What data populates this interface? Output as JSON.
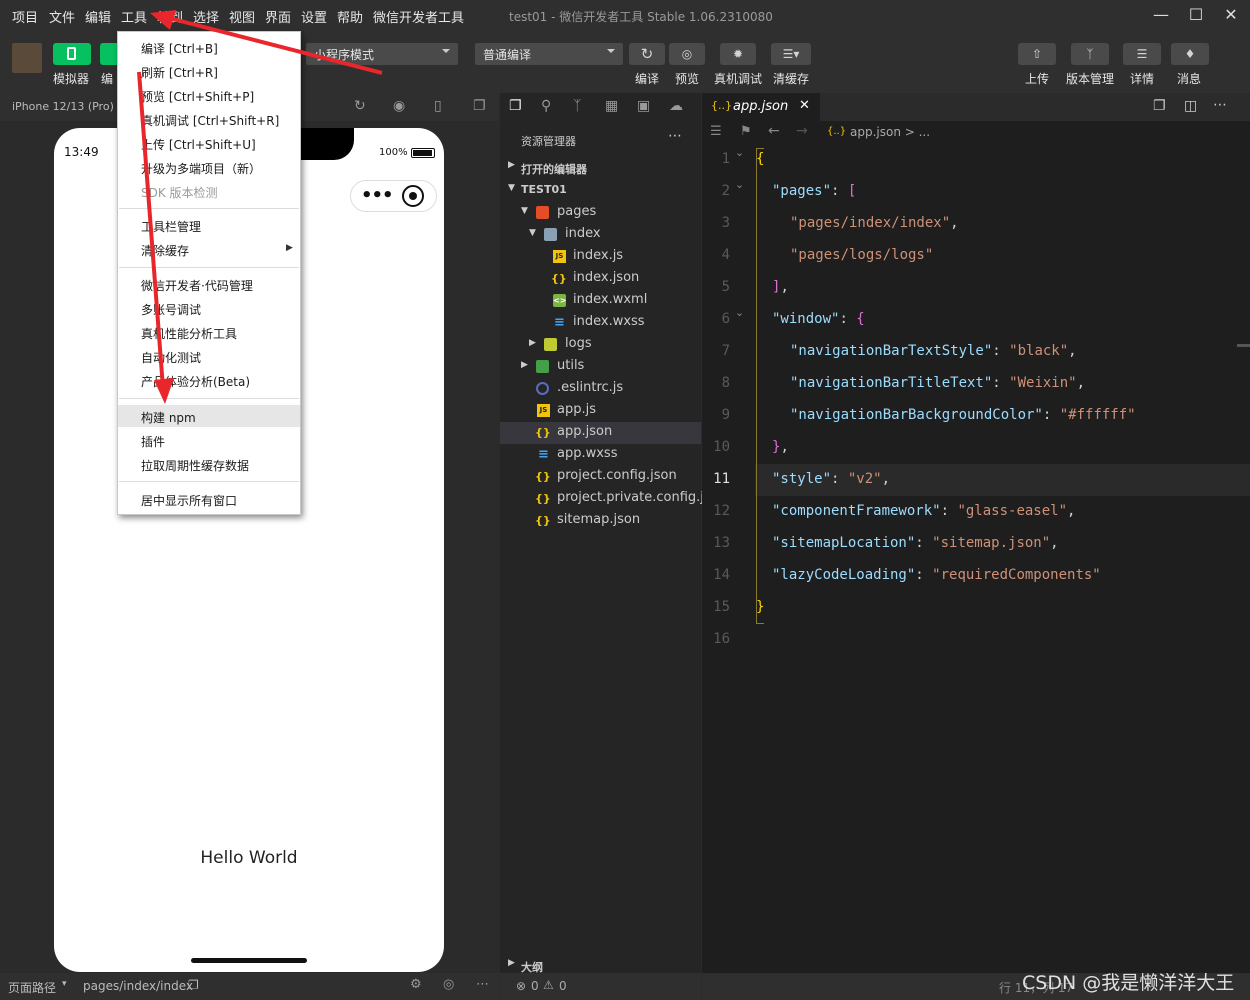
{
  "menubar": {
    "items": [
      "项目",
      "文件",
      "编辑",
      "工具",
      "转到",
      "选择",
      "视图",
      "界面",
      "设置",
      "帮助",
      "微信开发者工具"
    ],
    "window_title": "test01 - 微信开发者工具 Stable 1.06.2310080"
  },
  "toolbar": {
    "simulator_label": "模拟器",
    "editor_label": "编",
    "mode_select": "小程序模式",
    "compile_select": "普通编译",
    "compile_label": "编译",
    "preview_label": "预览",
    "remote_debug_label": "真机调试",
    "clear_cache_label": "清缓存",
    "upload_label": "上传",
    "version_label": "版本管理",
    "details_label": "详情",
    "messages_label": "消息"
  },
  "simulator": {
    "device": "iPhone 12/13 (Pro) 10",
    "time": "13:49",
    "battery": "100%",
    "hello": "Hello World",
    "footer_path_label": "页面路径",
    "footer_path": "pages/index/index"
  },
  "tools_menu": {
    "group1": [
      "编译 [Ctrl+B]",
      "刷新 [Ctrl+R]",
      "预览 [Ctrl+Shift+P]",
      "真机调试 [Ctrl+Shift+R]",
      "上传 [Ctrl+Shift+U]",
      "升级为多端项目（新）"
    ],
    "sdk_check": "SDK 版本检测",
    "group2": [
      "工具栏管理",
      "清除缓存"
    ],
    "group3": [
      "微信开发者·代码管理",
      "多账号调试",
      "真机性能分析工具",
      "自动化测试",
      "产品体验分析(Beta)"
    ],
    "group4": [
      "构建 npm",
      "插件",
      "拉取周期性缓存数据"
    ],
    "group5": [
      "居中显示所有窗口"
    ]
  },
  "explorer": {
    "title": "资源管理器",
    "open_editors": "打开的编辑器",
    "project": "TEST01",
    "tree": [
      {
        "name": "pages",
        "icon": "folder-icon"
      },
      {
        "name": "index",
        "icon": "folder-icon"
      },
      {
        "name": "index.js",
        "icon": "js-icon"
      },
      {
        "name": "index.json",
        "icon": "json-icon"
      },
      {
        "name": "index.wxml",
        "icon": "wxml-icon"
      },
      {
        "name": "index.wxss",
        "icon": "wxss-icon"
      },
      {
        "name": "logs",
        "icon": "folder-icon"
      },
      {
        "name": "utils",
        "icon": "folder-icon"
      },
      {
        "name": ".eslintrc.js",
        "icon": "eslint-icon"
      },
      {
        "name": "app.js",
        "icon": "js-icon"
      },
      {
        "name": "app.json",
        "icon": "json-icon"
      },
      {
        "name": "app.wxss",
        "icon": "wxss-icon"
      },
      {
        "name": "project.config.json",
        "icon": "json-icon"
      },
      {
        "name": "project.private.config.js...",
        "icon": "json-icon"
      },
      {
        "name": "sitemap.json",
        "icon": "json-icon"
      }
    ],
    "outline": "大纲",
    "problems": "0",
    "warnings": "0"
  },
  "editor": {
    "tab": "app.json",
    "breadcrumb": "app.json > ...",
    "line_numbers": [
      "1",
      "2",
      "3",
      "4",
      "5",
      "6",
      "7",
      "8",
      "9",
      "10",
      "11",
      "12",
      "13",
      "14",
      "15",
      "16"
    ],
    "status": "行 11，列 17"
  },
  "watermark": "CSDN @我是懒洋洋大王",
  "colors": {
    "accent_green": "#07c160",
    "arrow_red": "#e8262b"
  }
}
